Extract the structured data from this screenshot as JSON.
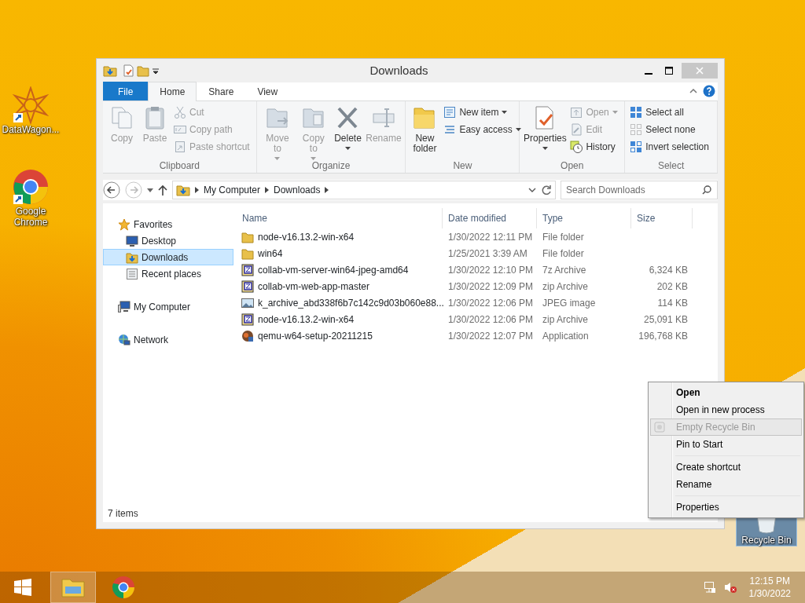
{
  "desktop_icons": [
    {
      "label": "DataWagon...",
      "kind": "starburst",
      "selected": false
    },
    {
      "label": "Google Chrome",
      "kind": "browser",
      "selected": false
    },
    {
      "label": "Recycle Bin",
      "kind": "bin",
      "selected": true
    }
  ],
  "window": {
    "title": "Downloads",
    "ribbon_tabs": [
      {
        "label": "File",
        "kind": "file",
        "selected": false
      },
      {
        "label": "Home",
        "kind": "tab",
        "selected": true
      },
      {
        "label": "Share",
        "kind": "tab",
        "selected": false
      },
      {
        "label": "View",
        "kind": "tab",
        "selected": false
      }
    ],
    "ribbon_groups": [
      {
        "label": "Clipboard",
        "commands": [
          {
            "kind": "large",
            "label": "Copy",
            "disabled": true,
            "dropdown": false
          },
          {
            "kind": "large",
            "label": "Paste",
            "disabled": true,
            "dropdown": false
          },
          {
            "kind": "stack",
            "items": [
              {
                "label": "Cut",
                "disabled": true,
                "dropdown": false
              },
              {
                "label": "Copy path",
                "disabled": true,
                "dropdown": false
              },
              {
                "label": "Paste shortcut",
                "disabled": true,
                "dropdown": false
              }
            ]
          }
        ]
      },
      {
        "label": "Organize",
        "commands": [
          {
            "kind": "large",
            "label": "Move to",
            "disabled": true,
            "dropdown": true
          },
          {
            "kind": "large",
            "label": "Copy to",
            "disabled": true,
            "dropdown": true
          },
          {
            "kind": "large",
            "label": "Delete",
            "disabled": false,
            "dropdown": true
          },
          {
            "kind": "large",
            "label": "Rename",
            "disabled": true,
            "dropdown": false
          }
        ]
      },
      {
        "label": "New",
        "commands": [
          {
            "kind": "large",
            "label": "New folder",
            "disabled": false,
            "dropdown": false
          },
          {
            "kind": "stack",
            "items": [
              {
                "label": "New item",
                "disabled": false,
                "dropdown": true
              },
              {
                "label": "Easy access",
                "disabled": false,
                "dropdown": true
              }
            ]
          }
        ]
      },
      {
        "label": "Open",
        "commands": [
          {
            "kind": "large",
            "label": "Properties",
            "disabled": false,
            "dropdown": true
          },
          {
            "kind": "stack",
            "items": [
              {
                "label": "Open",
                "disabled": true,
                "dropdown": true
              },
              {
                "label": "Edit",
                "disabled": true,
                "dropdown": false
              },
              {
                "label": "History",
                "disabled": false,
                "dropdown": false
              }
            ]
          }
        ]
      },
      {
        "label": "Select",
        "commands": [
          {
            "kind": "stack",
            "items": [
              {
                "label": "Select all",
                "disabled": false,
                "dropdown": false
              },
              {
                "label": "Select none",
                "disabled": false,
                "dropdown": false
              },
              {
                "label": "Invert selection",
                "disabled": false,
                "dropdown": false
              }
            ]
          }
        ]
      }
    ],
    "address": {
      "path": [
        "My Computer",
        "Downloads"
      ],
      "placeholder": "Search Downloads"
    },
    "navigation": [
      {
        "label": "Favorites",
        "selected": false,
        "children": [
          {
            "label": "Desktop",
            "selected": false
          },
          {
            "label": "Downloads",
            "selected": true
          },
          {
            "label": "Recent places",
            "selected": false
          }
        ]
      },
      {
        "label": "My Computer",
        "selected": false
      },
      {
        "label": "Network",
        "selected": false
      }
    ],
    "columns": [
      "Name",
      "Date modified",
      "Type",
      "Size"
    ],
    "rows": [
      {
        "kind": "folder",
        "name": "node-v16.13.2-win-x64",
        "date": "1/30/2022 12:11 PM",
        "type": "File folder",
        "size": ""
      },
      {
        "kind": "folder",
        "name": "win64",
        "date": "1/25/2021 3:39 AM",
        "type": "File folder",
        "size": ""
      },
      {
        "kind": "archive",
        "name": "collab-vm-server-win64-jpeg-amd64",
        "date": "1/30/2022 12:10 PM",
        "type": "7z Archive",
        "size": "6,324 KB"
      },
      {
        "kind": "archive",
        "name": "collab-vm-web-app-master",
        "date": "1/30/2022 12:09 PM",
        "type": "zip Archive",
        "size": "202 KB"
      },
      {
        "kind": "image",
        "name": "k_archive_abd338f6b7c142c9d03b060e88...",
        "date": "1/30/2022 12:06 PM",
        "type": "JPEG image",
        "size": "114 KB"
      },
      {
        "kind": "archive",
        "name": "node-v16.13.2-win-x64",
        "date": "1/30/2022 12:06 PM",
        "type": "zip Archive",
        "size": "25,091 KB"
      },
      {
        "kind": "app",
        "name": "qemu-w64-setup-20211215",
        "date": "1/30/2022 12:07 PM",
        "type": "Application",
        "size": "196,768 KB"
      }
    ],
    "status": "7 items"
  },
  "context_menu": {
    "groups": [
      {
        "items": [
          {
            "label": "Open",
            "default": true,
            "disabled": false,
            "selected": false
          },
          {
            "label": "Open in new process",
            "default": false,
            "disabled": false,
            "selected": false
          },
          {
            "label": "Empty Recycle Bin",
            "default": false,
            "disabled": true,
            "selected": true,
            "icon": true
          },
          {
            "label": "Pin to Start",
            "default": false,
            "disabled": false,
            "selected": false
          }
        ]
      },
      {
        "items": [
          {
            "label": "Create shortcut",
            "default": false,
            "disabled": false,
            "selected": false
          },
          {
            "label": "Rename",
            "default": false,
            "disabled": false,
            "selected": false
          }
        ]
      },
      {
        "items": [
          {
            "label": "Properties",
            "default": false,
            "disabled": false,
            "selected": false
          }
        ]
      }
    ]
  },
  "taskbar": {
    "buttons": [
      {
        "kind": "start",
        "selected": false
      },
      {
        "kind": "explorer",
        "selected": true
      },
      {
        "kind": "browser",
        "selected": false
      }
    ],
    "time": "12:15 PM",
    "date": "1/30/2022"
  }
}
